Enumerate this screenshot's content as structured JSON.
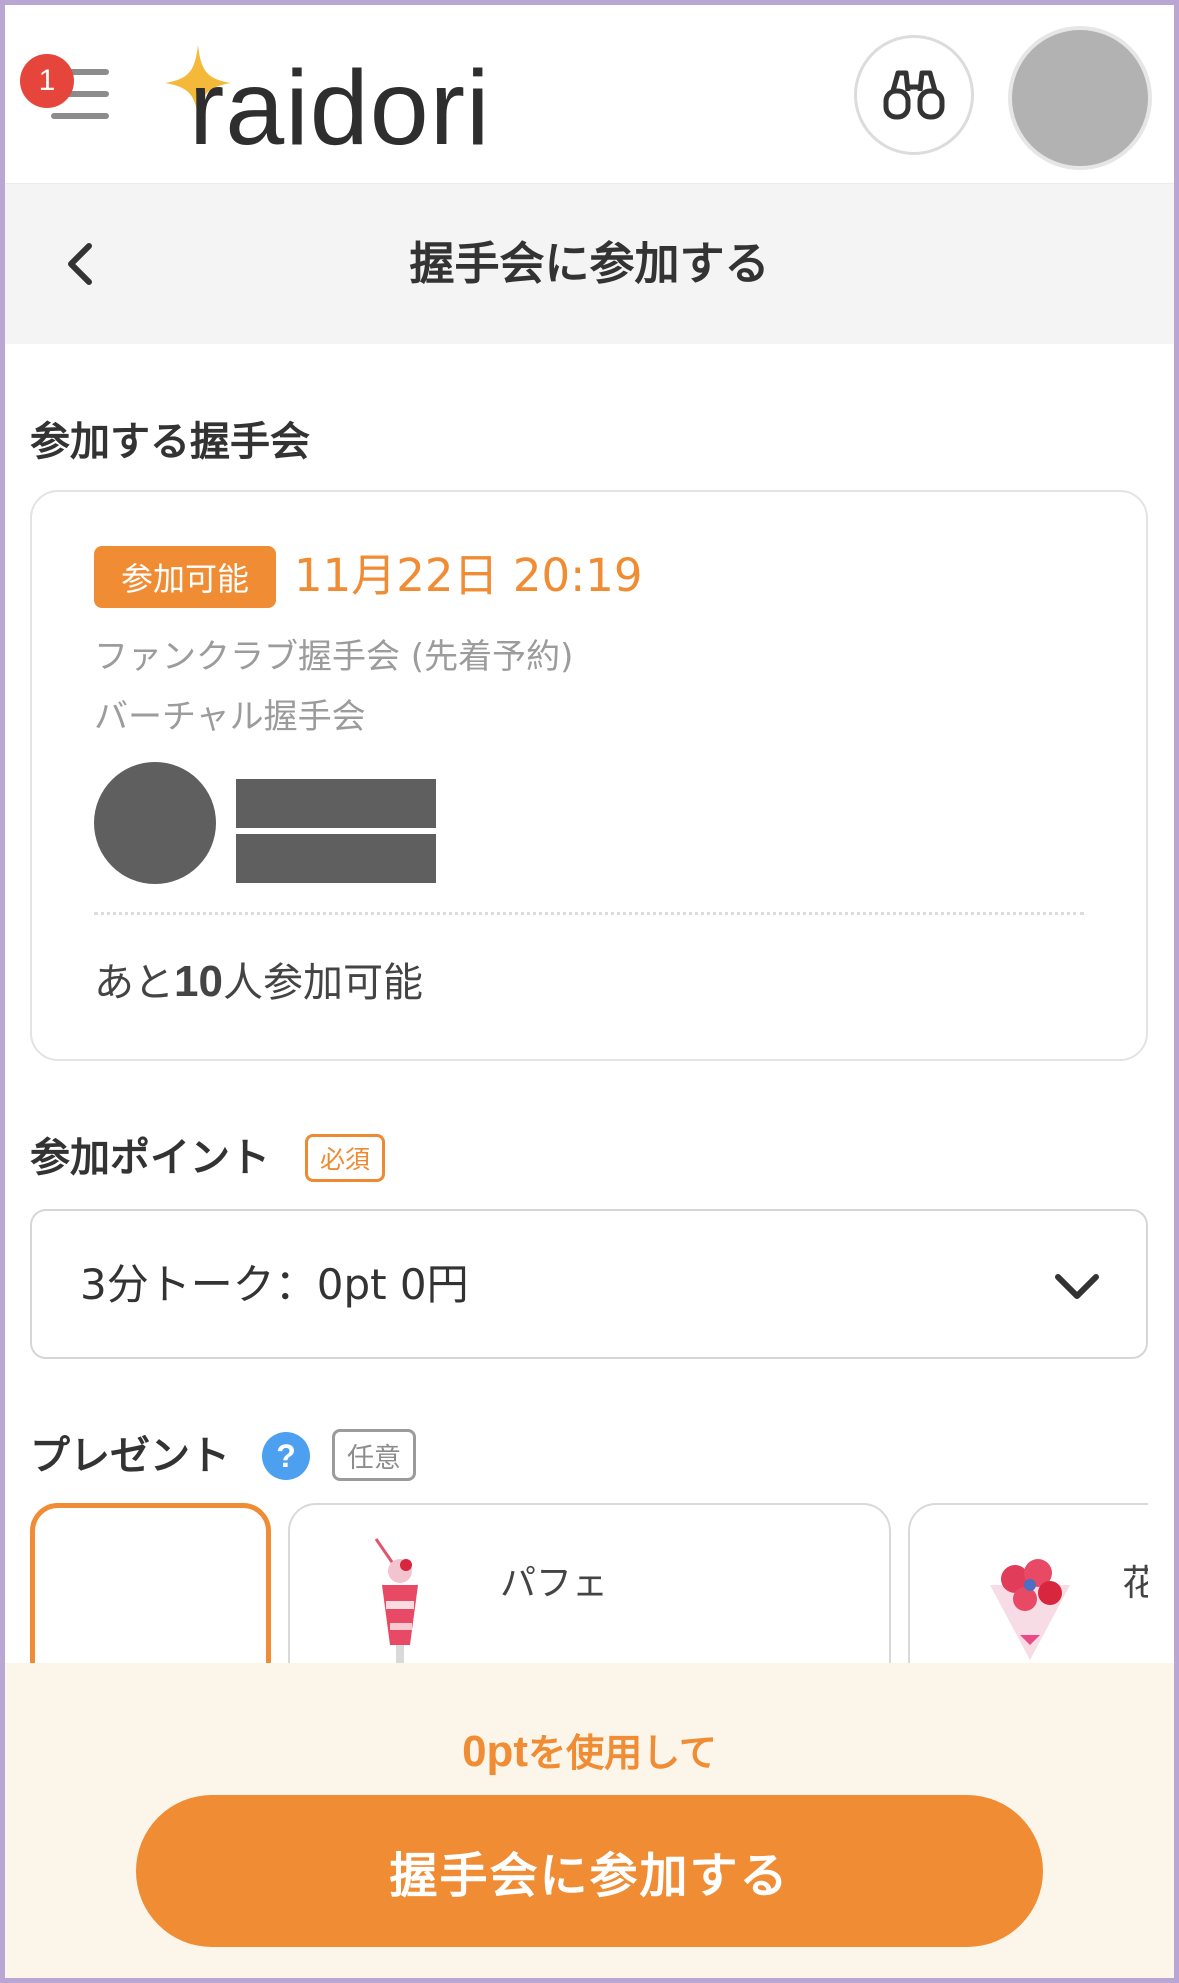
{
  "header": {
    "notification_count": "1",
    "logo_text": "raidori",
    "brand_color": "#ef8c34"
  },
  "subheader": {
    "title": "握手会に参加する"
  },
  "event_section": {
    "title": "参加する握手会",
    "card": {
      "status": "参加可能",
      "date": "11月22日 20:19",
      "event_type": "ファンクラブ握手会 (先着予約)",
      "format": "バーチャル握手会",
      "remaining_prefix": "あと",
      "remaining_count": "10",
      "remaining_suffix": "人参加可能"
    }
  },
  "points_section": {
    "title": "参加ポイント",
    "required_tag": "必須",
    "selected_value": "3分トーク：0pt 0円"
  },
  "present_section": {
    "title": "プレゼント",
    "help_icon": "?",
    "optional_tag": "任意",
    "items": [
      {
        "label": ""
      },
      {
        "label": "パフェ"
      },
      {
        "label": "花"
      }
    ]
  },
  "footer": {
    "points_amount": "0pt",
    "points_suffix": "を使用して",
    "join_button": "握手会に参加する"
  }
}
